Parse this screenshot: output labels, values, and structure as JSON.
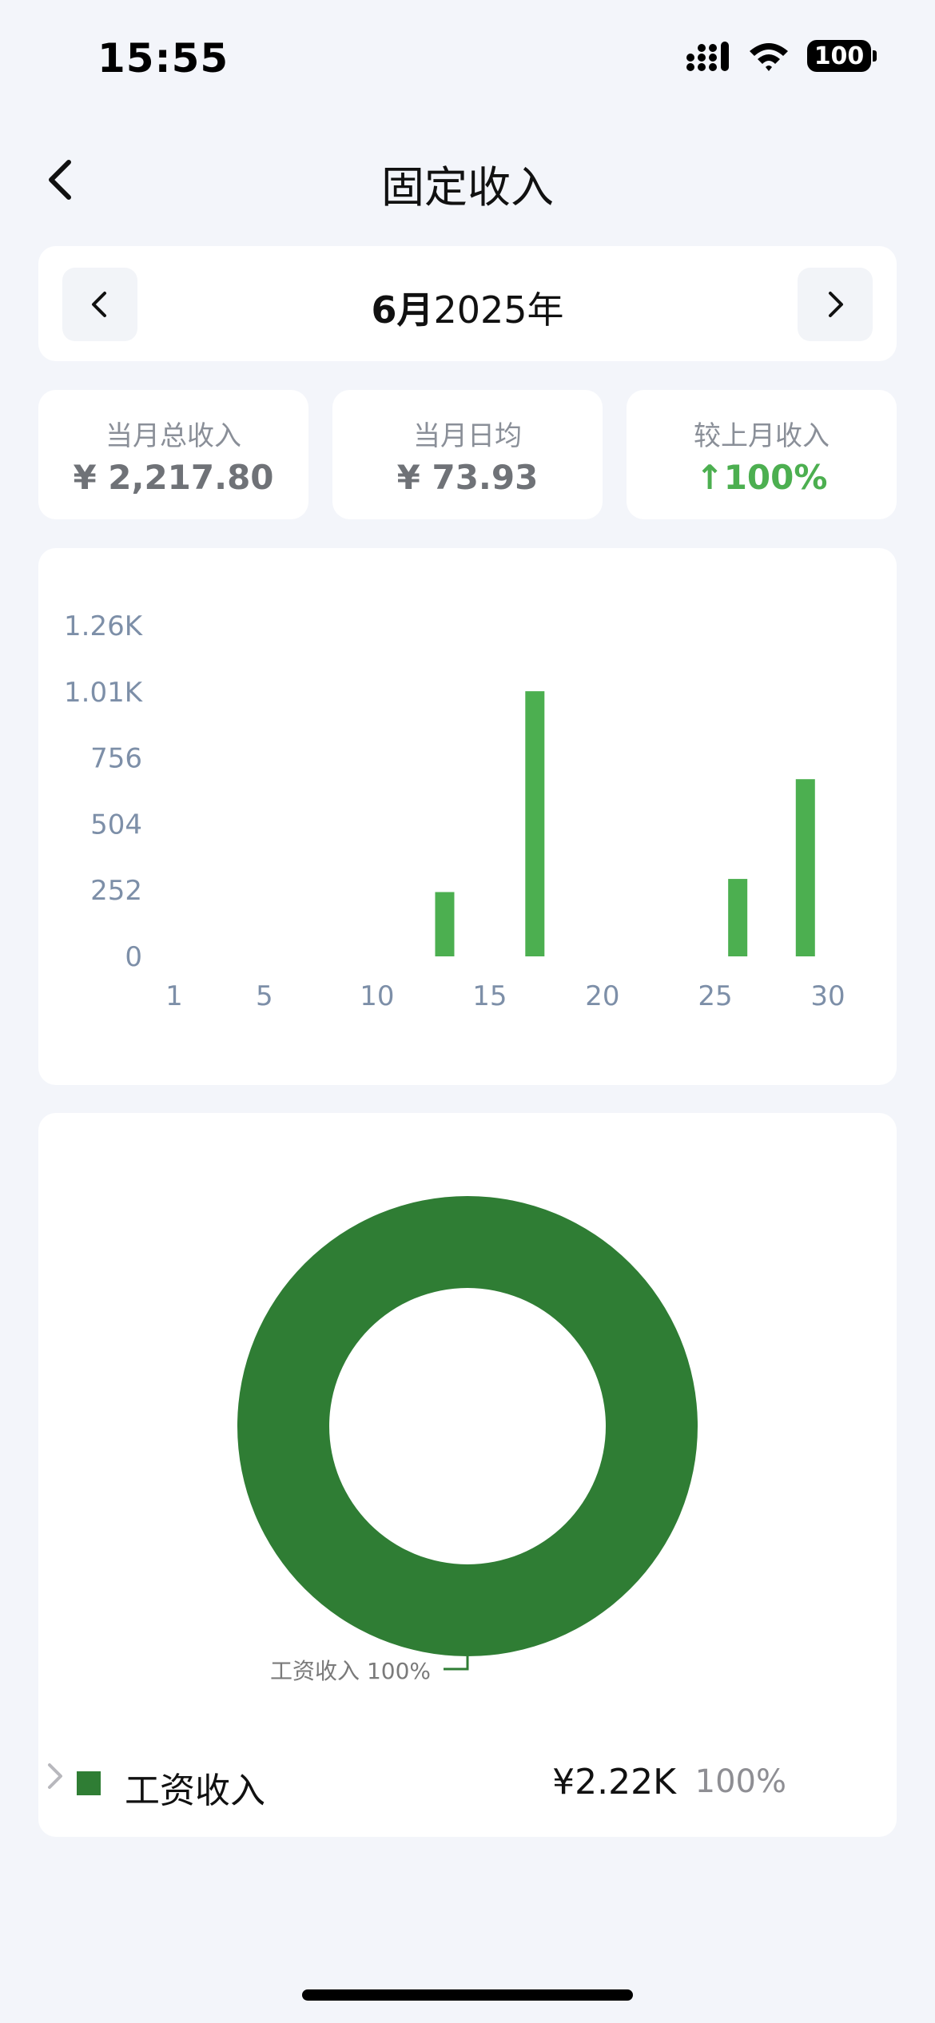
{
  "status_bar": {
    "time": "15:55",
    "battery": "100"
  },
  "nav": {
    "title": "固定收入"
  },
  "month_selector": {
    "month": "6月",
    "year": "2025年"
  },
  "stats": [
    {
      "label": "当月总收入",
      "value": "¥ 2,217.80"
    },
    {
      "label": "当月日均",
      "value": "¥ 73.93"
    },
    {
      "label": "较上月收入",
      "value": "↑100%"
    }
  ],
  "colors": {
    "bar": "#4caf50",
    "donut": "#2f7d34",
    "up": "#4caf50"
  },
  "chart_data": [
    {
      "type": "bar",
      "y_ticks": [
        "0",
        "252",
        "504",
        "756",
        "1.01K",
        "1.26K"
      ],
      "x_ticks": [
        1,
        5,
        10,
        15,
        20,
        25,
        30
      ],
      "xlim": [
        1,
        30
      ],
      "ylim": [
        0,
        1260
      ],
      "grid": false,
      "points": [
        {
          "x": 13,
          "y": 245
        },
        {
          "x": 17,
          "y": 1010
        },
        {
          "x": 26,
          "y": 295
        },
        {
          "x": 29,
          "y": 675
        }
      ]
    },
    {
      "type": "pie",
      "donut": true,
      "slices": [
        {
          "name": "工资收入",
          "value": 100,
          "label": "工资收入 100%"
        }
      ]
    }
  ],
  "legend": [
    {
      "name": "工资收入",
      "amount": "¥2.22K",
      "percent": "100%"
    }
  ]
}
